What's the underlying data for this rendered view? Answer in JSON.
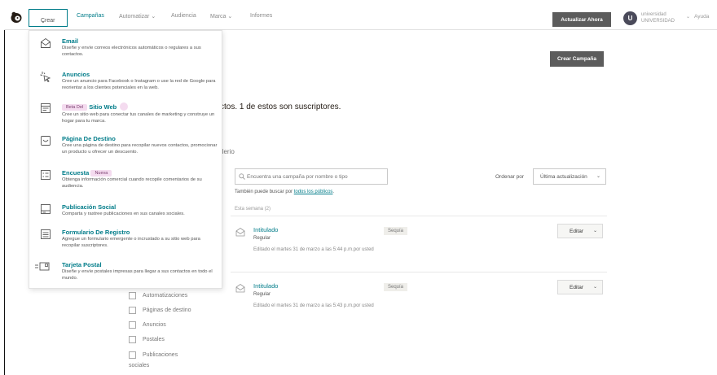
{
  "nav": {
    "crear": "Crear",
    "campanas": "Campañas",
    "automatizar": "Automatizar",
    "audiencia": "Audiencia",
    "marca": "Marca",
    "informes": "Informes",
    "upgrade": "Actualizar Ahora",
    "avatar_initial": "U",
    "account_line1": "universidad",
    "account_line2": "UNIVERSIDAD",
    "help": "Ayuda"
  },
  "page": {
    "create_campaign": "Crear Campaña",
    "contacts_text": "ctos. 1 de estos son suscriptores.",
    "calendar_text": "derio",
    "search_placeholder": "Encuentra una campaña por nombre o tipo",
    "hint_prefix": "También puede buscar por",
    "hint_link": "todos los públicos",
    "hint_suffix": ".",
    "sort_label": "Ordenar por",
    "sort_value": "Última actualización",
    "week_label": "Esta semana (2)"
  },
  "campaigns": [
    {
      "title": "Intitulado",
      "type": "Regular",
      "badge": "Sequía",
      "edited": "Editado el martes 31 de marzo a las 5:44 p.m.por usted",
      "edit_label": "Editar"
    },
    {
      "title": "Intitulado",
      "type": "Regular",
      "badge": "Sequía",
      "edited": "Editado el martes 31 de marzo a las 5:43 p.m.por usted",
      "edit_label": "Editar"
    }
  ],
  "sidebar": {
    "items": [
      "Automatizaciones",
      "Páginas de destino",
      "Anuncios",
      "Postales",
      "Publicaciones"
    ],
    "items_tail": "sociales"
  },
  "dropdown": {
    "email_title": "Email",
    "email_desc": "Diseñe y envíe correos electrónicos automáticos o regulares a sus contactos.",
    "ads_title": "Anuncios",
    "ads_desc": "Cree un anuncio para Facebook o Instagram o use la red de Google para reorientar a los clientes potenciales en la web.",
    "web_badge": "Beta Del",
    "web_title": "Sitio Web",
    "web_desc": "Cree un sitio web para conectar tus canales de marketing y construye un hogar para tu marca.",
    "landing_title": "Página De Destino",
    "landing_desc": "Cree una página de destino para recopilar nuevos contactos, promocionar un producto u ofrecer un descuento.",
    "survey_title": "Encuesta",
    "survey_badge": "Nueva",
    "survey_desc": "Obtenga información comercial cuando recopile comentarios de su audiencia.",
    "social_title": "Publicación Social",
    "social_desc": "Comparta y rastree publicaciones en sus canales sociales.",
    "form_title": "Formulario De Registro",
    "form_desc": "Agregue un formulario emergente o incrustado a su sitio web para recopilar suscriptores.",
    "postcard_title": "Tarjeta Postal",
    "postcard_desc": "Diseñe y envíe postales impresas para llegar a sus contactos en todo el mundo."
  },
  "colors": {
    "accent": "#007c89",
    "button_dark": "#5c5c5c",
    "badge_pink": "#f4dbef"
  }
}
